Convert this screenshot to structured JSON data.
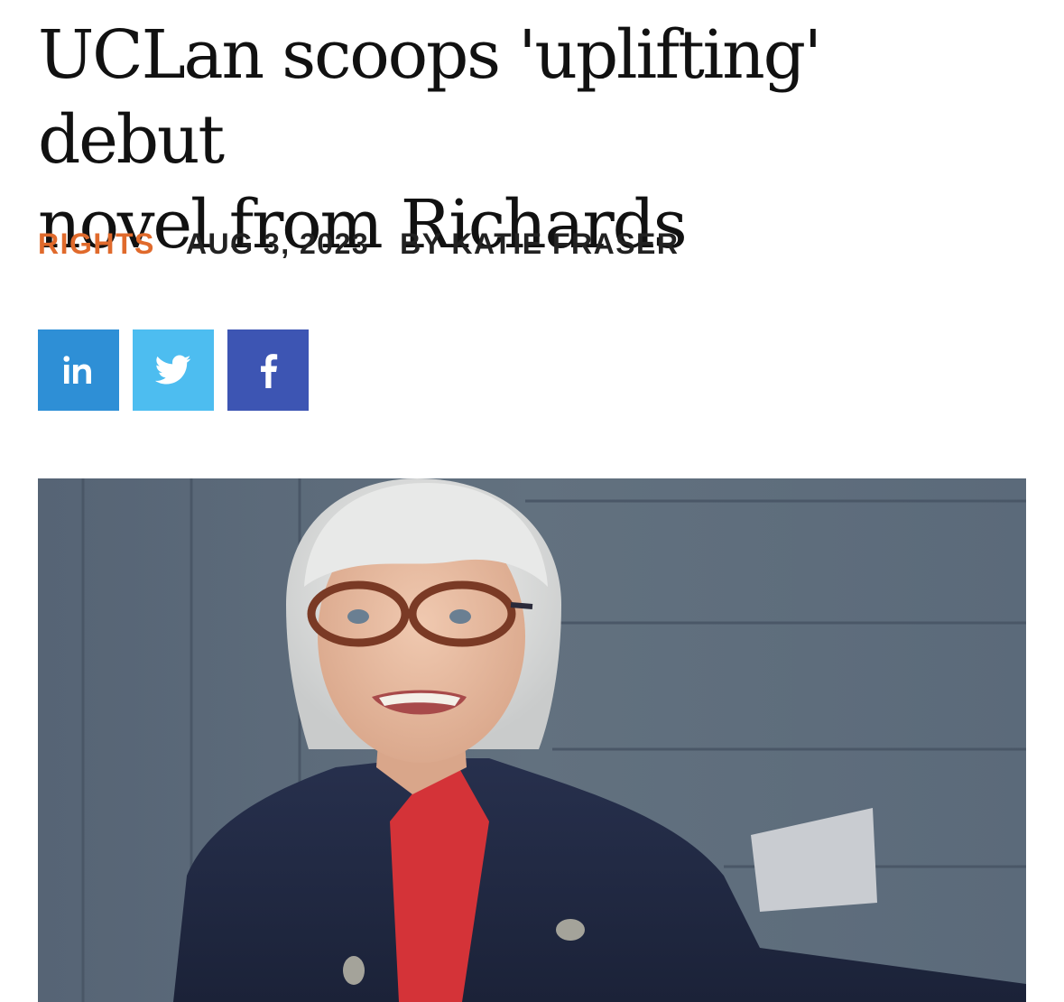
{
  "article": {
    "headline_line1": "UCLan scoops 'uplifting' debut",
    "headline_line2": "novel from Richards",
    "category": "RIGHTS",
    "date": "AUG 3, 2023",
    "byline": "BY KATIE FRASER"
  },
  "share": [
    {
      "network": "linkedin",
      "icon": "linkedin-icon",
      "color": "#2e8fd6"
    },
    {
      "network": "twitter",
      "icon": "twitter-icon",
      "color": "#4dbdf0"
    },
    {
      "network": "facebook",
      "icon": "facebook-icon",
      "color": "#3d55b3"
    }
  ],
  "colors": {
    "accent": "#e06a2c",
    "text": "#111111"
  },
  "hero_image": {
    "subject": "author-portrait"
  }
}
